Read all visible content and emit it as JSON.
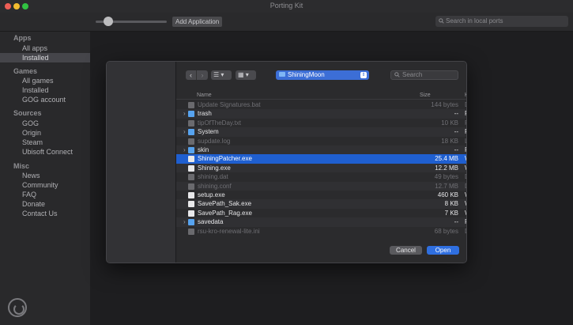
{
  "window": {
    "title": "Porting Kit"
  },
  "toolbar": {
    "add_application_label": "Add Application",
    "search_placeholder": "Search in local ports"
  },
  "sidebar": {
    "sections": [
      {
        "heading": "Apps",
        "items": [
          "All apps",
          "Installed"
        ]
      },
      {
        "heading": "Games",
        "items": [
          "All games",
          "Installed",
          "GOG account"
        ]
      },
      {
        "heading": "Sources",
        "items": [
          "GOG",
          "Origin",
          "Steam",
          "Ubisoft Connect"
        ]
      },
      {
        "heading": "Misc",
        "items": [
          "News",
          "Community",
          "FAQ",
          "Donate",
          "Contact Us"
        ]
      }
    ],
    "selected": "Apps/Installed"
  },
  "dialog": {
    "location": "ShiningMoon",
    "search_placeholder": "Search",
    "columns": {
      "name": "Name",
      "size": "Size",
      "kind": "Ki"
    },
    "files": [
      {
        "name": "Update Signatures.bat",
        "size": "144 bytes",
        "kind": "D",
        "type": "file",
        "dim": true
      },
      {
        "name": "trash",
        "size": "--",
        "kind": "F",
        "type": "folder",
        "dim": false
      },
      {
        "name": "tipOfTheDay.txt",
        "size": "10 KB",
        "kind": "P",
        "type": "file",
        "dim": true
      },
      {
        "name": "System",
        "size": "--",
        "kind": "F",
        "type": "folder",
        "dim": false
      },
      {
        "name": "supdate.log",
        "size": "18 KB",
        "kind": "L",
        "type": "file",
        "dim": true
      },
      {
        "name": "skin",
        "size": "--",
        "kind": "F",
        "type": "folder",
        "dim": false
      },
      {
        "name": "ShiningPatcher.exe",
        "size": "25.4 MB",
        "kind": "W",
        "type": "file",
        "dim": false,
        "selected": true
      },
      {
        "name": "Shining.exe",
        "size": "12.2 MB",
        "kind": "W",
        "type": "file",
        "dim": false
      },
      {
        "name": "shining.dat",
        "size": "49 bytes",
        "kind": "D",
        "type": "file",
        "dim": true
      },
      {
        "name": "shining.conf",
        "size": "12.7 MB",
        "kind": "D",
        "type": "file",
        "dim": true
      },
      {
        "name": "setup.exe",
        "size": "460 KB",
        "kind": "W",
        "type": "file",
        "dim": false
      },
      {
        "name": "SavePath_Sak.exe",
        "size": "8 KB",
        "kind": "W",
        "type": "file",
        "dim": false
      },
      {
        "name": "SavePath_Rag.exe",
        "size": "7 KB",
        "kind": "W",
        "type": "file",
        "dim": false
      },
      {
        "name": "savedata",
        "size": "--",
        "kind": "F",
        "type": "folder",
        "dim": false
      },
      {
        "name": "rsu-kro-renewal-lite.ini",
        "size": "68 bytes",
        "kind": "D",
        "type": "file",
        "dim": true
      }
    ],
    "cancel_label": "Cancel",
    "open_label": "Open"
  },
  "colors": {
    "accent": "#2f6fe0",
    "selection": "#1f5fd0",
    "folder": "#57a3ef"
  }
}
